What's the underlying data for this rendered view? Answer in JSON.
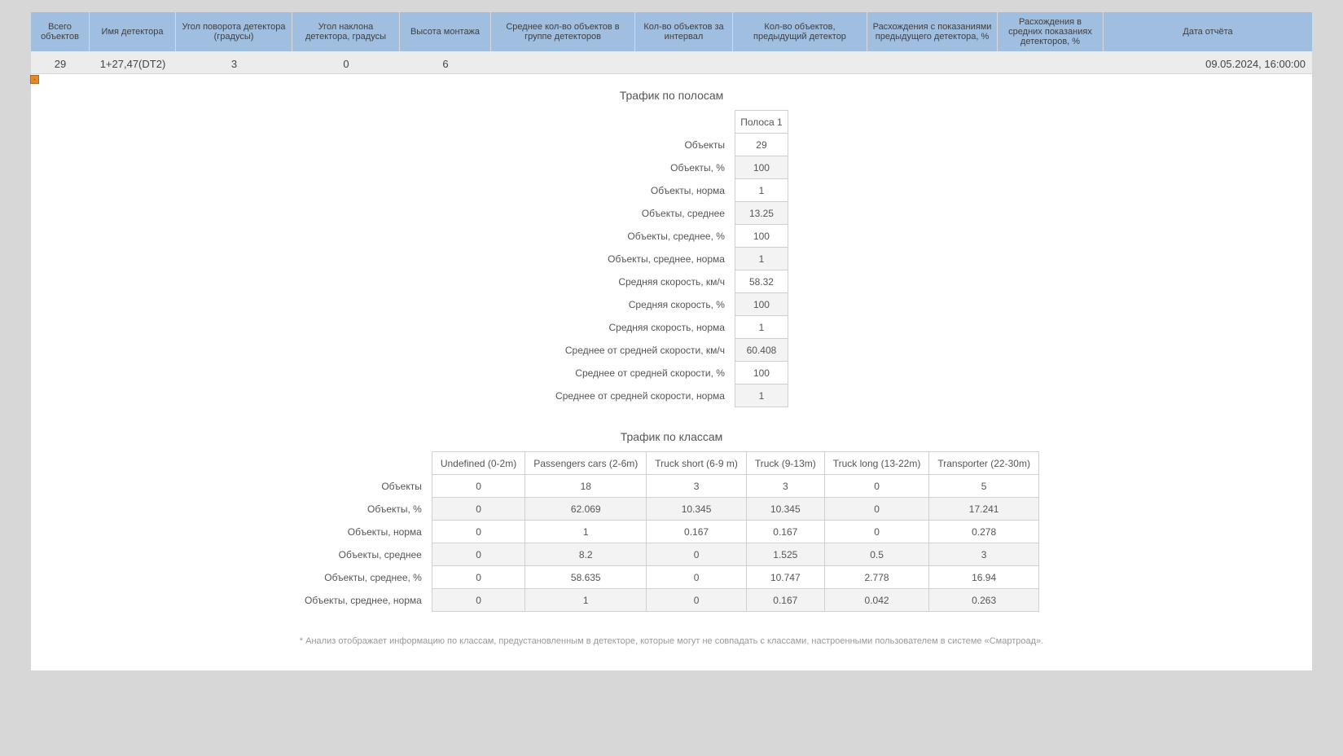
{
  "header": {
    "cols": [
      "Всего объектов",
      "Имя детектора",
      "Угол поворота детектора (градусы)",
      "Угол наклона детектора, градусы",
      "Высота монтажа",
      "Среднее кол-во объектов в группе детекторов",
      "Кол-во объектов за интервал",
      "Кол-во объектов, предыдущий детектор",
      "Расхождения с показаниями предыдущего детектора, %",
      "Расхождения в средних показаниях детекторов, %",
      "Дата отчёта"
    ]
  },
  "row": {
    "total_objects": "29",
    "detector_name": "1+27,47(DT2)",
    "rotation": "3",
    "tilt": "0",
    "height": "6",
    "avg_group": "",
    "interval": "",
    "prev_detector": "",
    "disc_prev": "",
    "disc_avg": "",
    "report_date": "09.05.2024, 16:00:00",
    "expand_icon": "-"
  },
  "lanes": {
    "title": "Трафик по полосам",
    "col_header": "Полоса 1",
    "rows": [
      {
        "label": "Объекты",
        "value": "29"
      },
      {
        "label": "Объекты, %",
        "value": "100"
      },
      {
        "label": "Объекты, норма",
        "value": "1"
      },
      {
        "label": "Объекты, среднее",
        "value": "13.25"
      },
      {
        "label": "Объекты, среднее, %",
        "value": "100"
      },
      {
        "label": "Объекты, среднее, норма",
        "value": "1"
      },
      {
        "label": "Средняя скорость, км/ч",
        "value": "58.32"
      },
      {
        "label": "Средняя скорость, %",
        "value": "100"
      },
      {
        "label": "Средняя скорость, норма",
        "value": "1"
      },
      {
        "label": "Среднее от средней скорости, км/ч",
        "value": "60.408"
      },
      {
        "label": "Среднее от средней скорости, %",
        "value": "100"
      },
      {
        "label": "Среднее от средней скорости, норма",
        "value": "1"
      }
    ]
  },
  "classes": {
    "title": "Трафик по классам",
    "col_headers": [
      "Undefined (0-2m)",
      "Passengers cars (2-6m)",
      "Truck short (6-9 m)",
      "Truck (9-13m)",
      "Truck long (13-22m)",
      "Transporter (22-30m)"
    ],
    "rows": [
      {
        "label": "Объекты",
        "values": [
          "0",
          "18",
          "3",
          "3",
          "0",
          "5"
        ]
      },
      {
        "label": "Объекты, %",
        "values": [
          "0",
          "62.069",
          "10.345",
          "10.345",
          "0",
          "17.241"
        ]
      },
      {
        "label": "Объекты, норма",
        "values": [
          "0",
          "1",
          "0.167",
          "0.167",
          "0",
          "0.278"
        ]
      },
      {
        "label": "Объекты, среднее",
        "values": [
          "0",
          "8.2",
          "0",
          "1.525",
          "0.5",
          "3"
        ]
      },
      {
        "label": "Объекты, среднее, %",
        "values": [
          "0",
          "58.635",
          "0",
          "10.747",
          "2.778",
          "16.94"
        ]
      },
      {
        "label": "Объекты, среднее, норма",
        "values": [
          "0",
          "1",
          "0",
          "0.167",
          "0.042",
          "0.263"
        ]
      }
    ]
  },
  "footnote": "* Анализ отображает информацию по классам, предустановленным в детекторе, которые могут не совпадать с классами, настроенными пользователем в системе «Смартроад»."
}
